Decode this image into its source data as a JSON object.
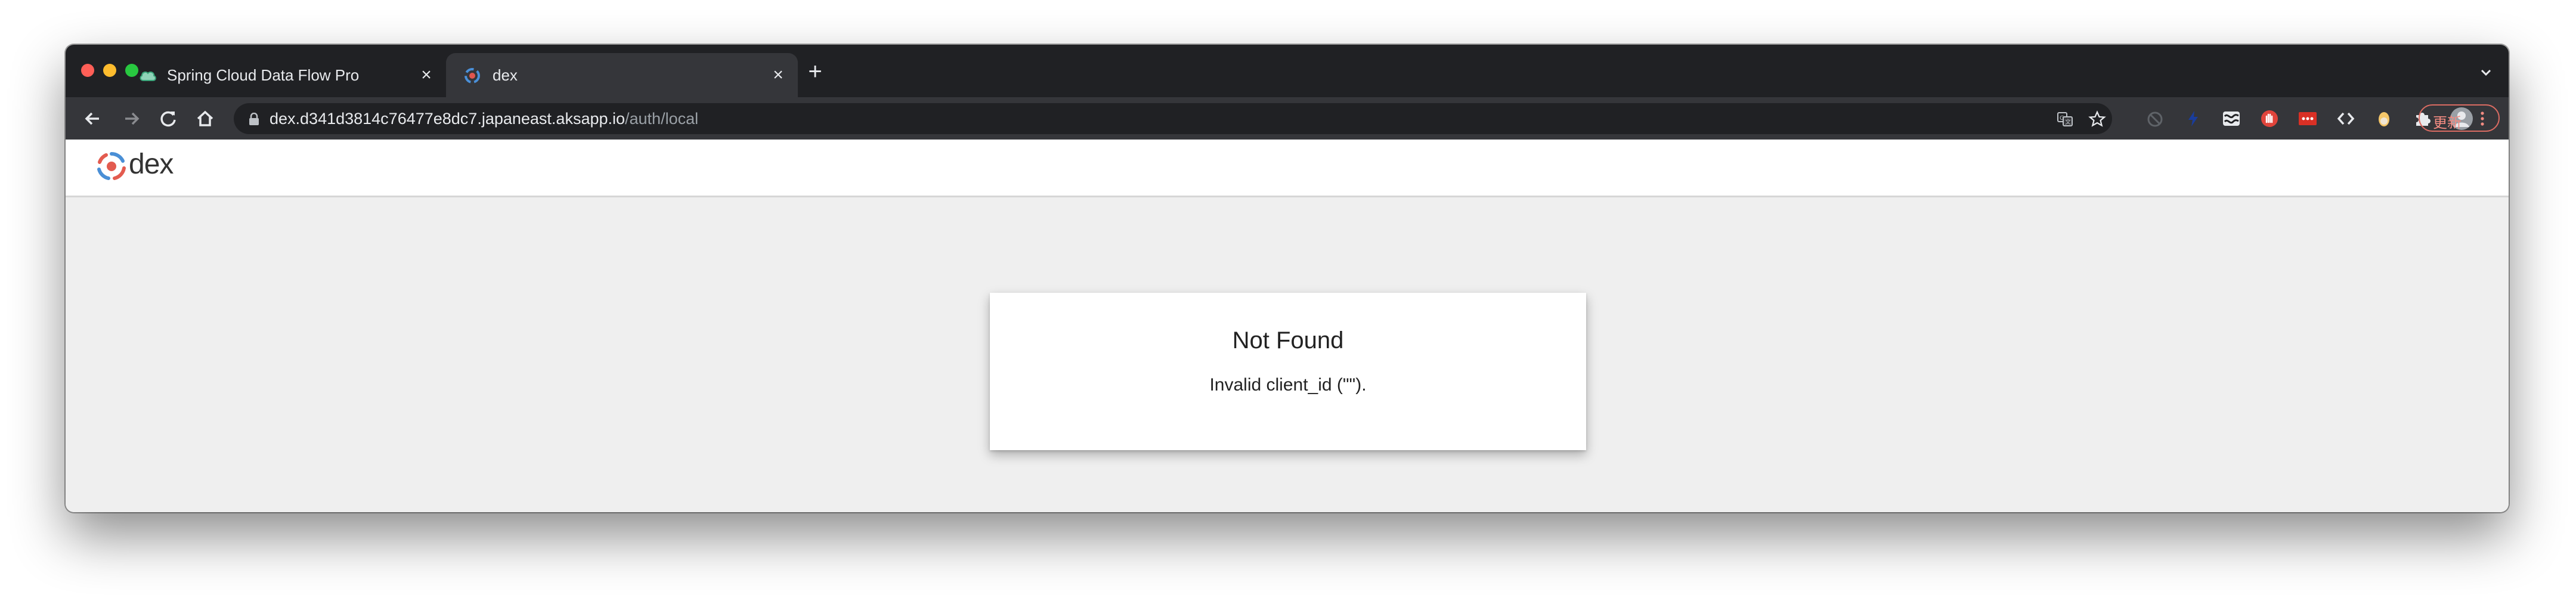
{
  "browser": {
    "tabs": [
      {
        "label": "Spring Cloud Data Flow Pro",
        "active": false
      },
      {
        "label": "dex",
        "active": true
      }
    ],
    "address": {
      "host": "dex.d341d3814c76477e8dc7.japaneast.aksapp.io",
      "path": "/auth/local"
    },
    "update_label": "更新"
  },
  "page": {
    "brand": "dex",
    "error_title": "Not Found",
    "error_message": "Invalid client_id (\"\")."
  },
  "colors": {
    "tabstrip": "#202124",
    "toolbar": "#35363a",
    "page_bg": "#efefef",
    "update_accent": "#f28b82"
  }
}
